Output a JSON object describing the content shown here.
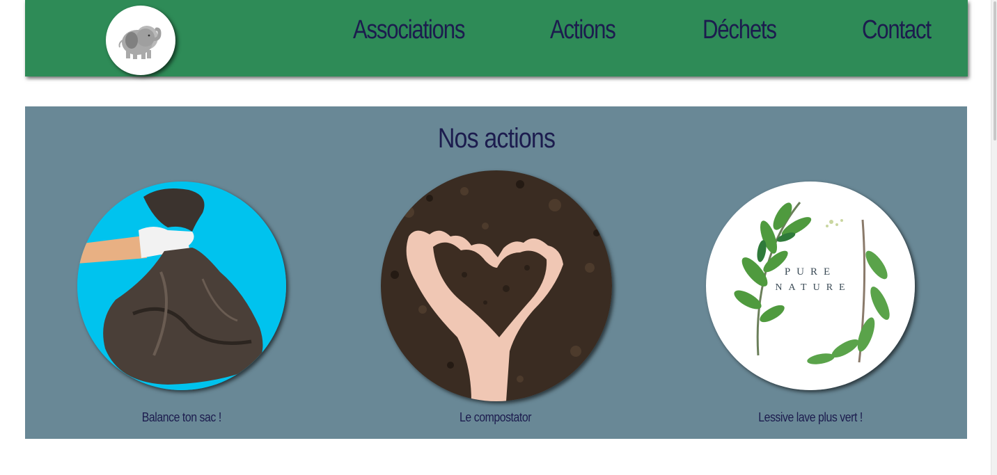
{
  "nav": {
    "items": [
      {
        "label": "Associations"
      },
      {
        "label": "Actions"
      },
      {
        "label": "Déchets"
      },
      {
        "label": "Contact"
      }
    ]
  },
  "main": {
    "title": "Nos actions",
    "cards": [
      {
        "caption": "Balance ton sac !",
        "image": "garbage-bag-photo"
      },
      {
        "caption": "Le compostator",
        "image": "soil-heart-hands-photo"
      },
      {
        "caption": "Lessive lave plus vert !",
        "image": "pure-nature-leaves-photo"
      }
    ],
    "pure_nature": {
      "line1": "PURE",
      "line2": "NATURE"
    }
  },
  "colors": {
    "header": "#2e8b57",
    "section": "#698896",
    "text": "#1c1c4e"
  },
  "icons": {
    "logo": "elephant-icon"
  }
}
